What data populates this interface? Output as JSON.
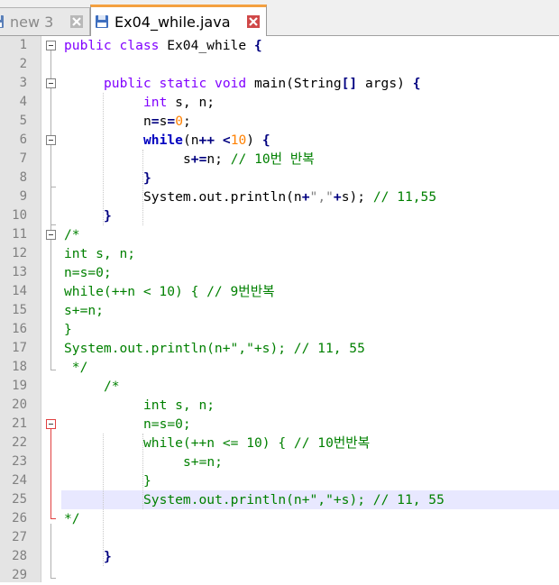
{
  "tabs": [
    {
      "label": "new 3",
      "active": false
    },
    {
      "label": "Ex04_while.java",
      "active": true
    }
  ],
  "line_numbers": [
    "1",
    "2",
    "3",
    "4",
    "5",
    "6",
    "7",
    "8",
    "9",
    "10",
    "11",
    "12",
    "13",
    "14",
    "15",
    "16",
    "17",
    "18",
    "19",
    "20",
    "21",
    "22",
    "23",
    "24",
    "25",
    "26",
    "27",
    "28",
    "29"
  ],
  "code": {
    "l1": {
      "a": "public",
      "b": " ",
      "c": "class",
      "d": " Ex04_while ",
      "e": "{"
    },
    "l3": {
      "a": "public",
      "b": " ",
      "c": "static",
      "d": " ",
      "e": "void",
      "f": " main(String",
      "g": "[]",
      "h": " args) ",
      "i": "{"
    },
    "l4": {
      "a": "int",
      "b": " s, n;"
    },
    "l5": {
      "a": "n",
      "b": "=",
      "c": "s",
      "d": "=",
      "e": "0",
      "f": ";"
    },
    "l6": {
      "a": "while",
      "b": "(n",
      "c": "++",
      "d": " ",
      "e": "<",
      "f": "10",
      "g": ") ",
      "h": "{"
    },
    "l7": {
      "a": "s",
      "b": "+=",
      "c": "n; ",
      "d": "// 10번 반복"
    },
    "l8": {
      "a": "}"
    },
    "l9": {
      "a": "System.out.println(n",
      "b": "+",
      "c": "\",\"",
      "d": "+",
      "e": "s); ",
      "f": "// 11,55"
    },
    "l10": {
      "a": "}"
    },
    "l11": "/*",
    "l12": "int s, n;",
    "l13": "n=s=0;",
    "l14": "while(++n < 10) { // 9번반복",
    "l15": "s+=n;",
    "l16": "}",
    "l17": "System.out.println(n+\",\"+s); // 11, 55",
    "l18": " */",
    "l19": "/*",
    "l20": "int s, n;",
    "l21": "n=s=0;",
    "l22": "while(++n <= 10) { // 10번반복",
    "l23": "s+=n;",
    "l24": "}",
    "l25": "System.out.println(n+\",\"+s); // 11, 55",
    "l26": "*/",
    "l28": "}"
  }
}
